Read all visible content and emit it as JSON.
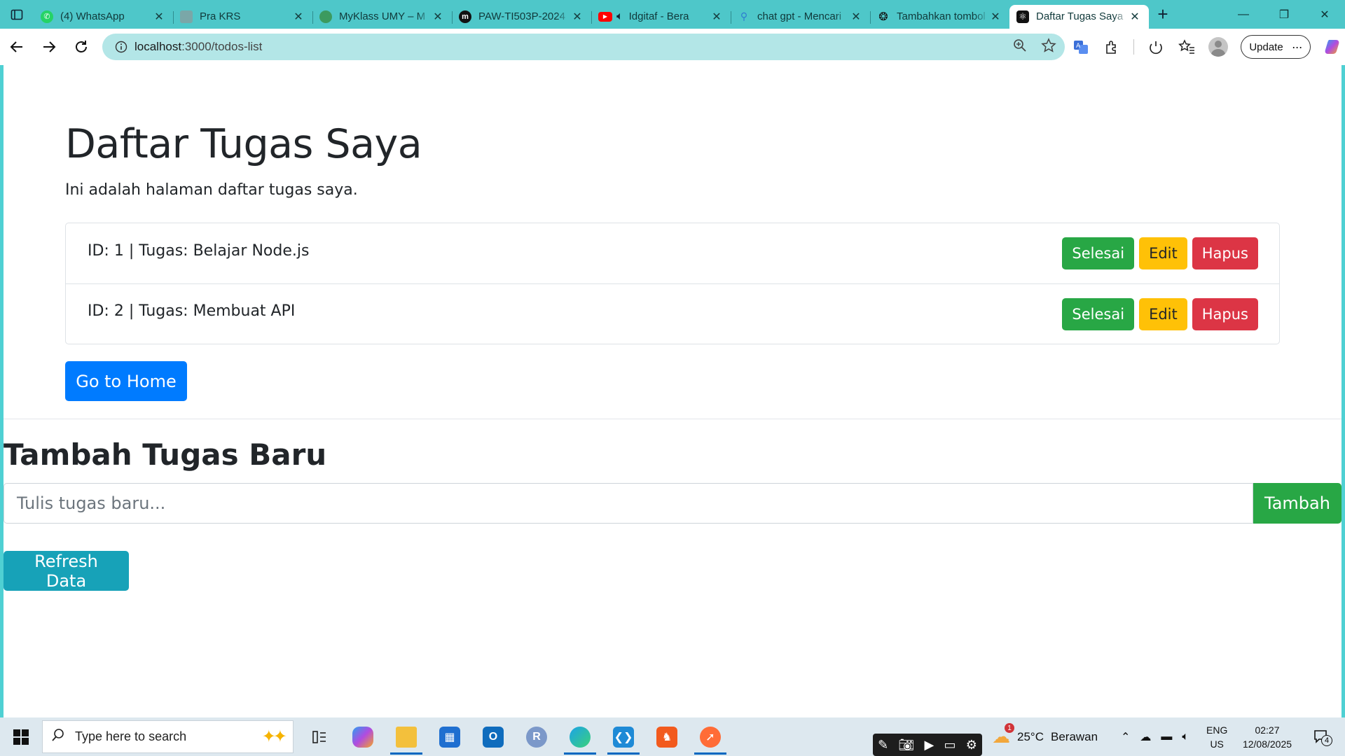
{
  "browser": {
    "tabs": [
      {
        "title": "(4) WhatsApp",
        "icon": "whatsapp-icon",
        "color": "#25d366"
      },
      {
        "title": "Pra KRS",
        "icon": "page-icon",
        "color": "#7aa7a8"
      },
      {
        "title": "MyKlass UMY – M",
        "icon": "myklass-icon",
        "color": "#3c9a5f"
      },
      {
        "title": "PAW-TI503P-2024",
        "icon": "medium-icon",
        "color": "#111111"
      },
      {
        "title": "Idgitaf - Bera",
        "icon": "youtube-icon",
        "color": "#ff0000"
      },
      {
        "title": "chat gpt - Mencari",
        "icon": "search-icon",
        "color": "#2d7bd1"
      },
      {
        "title": "Tambahkan tombol",
        "icon": "chatgpt-icon",
        "color": "#111111"
      },
      {
        "title": "Daftar Tugas Saya",
        "icon": "react-icon",
        "color": "#111111",
        "active": true
      }
    ],
    "url_host": "localhost",
    "url_path": ":3000/todos-list",
    "update_label": "Update"
  },
  "page": {
    "title": "Daftar Tugas Saya",
    "lead": "Ini adalah halaman daftar tugas saya.",
    "todos": [
      {
        "text": "ID: 1 | Tugas: Belajar Node.js"
      },
      {
        "text": "ID: 2 | Tugas: Membuat API"
      }
    ],
    "done_label": "Selesai",
    "edit_label": "Edit",
    "delete_label": "Hapus",
    "home_label": "Go to Home",
    "add_heading": "Tambah Tugas Baru",
    "input_placeholder": "Tulis tugas baru...",
    "add_label": "Tambah",
    "refresh_label": "Refresh Data"
  },
  "taskbar": {
    "search_placeholder": "Type here to search",
    "weather_temp": "25°C",
    "weather_desc": "Berawan",
    "weather_alert": "1",
    "lang_top": "ENG",
    "lang_bottom": "US",
    "time": "02:27",
    "date": "12/08/2025",
    "notification_count": "4"
  },
  "colors": {
    "accent": "#4ec7c9",
    "success": "#28a745",
    "warning": "#ffc107",
    "danger": "#dc3545",
    "primary": "#007bff",
    "info": "#17a2b8"
  }
}
